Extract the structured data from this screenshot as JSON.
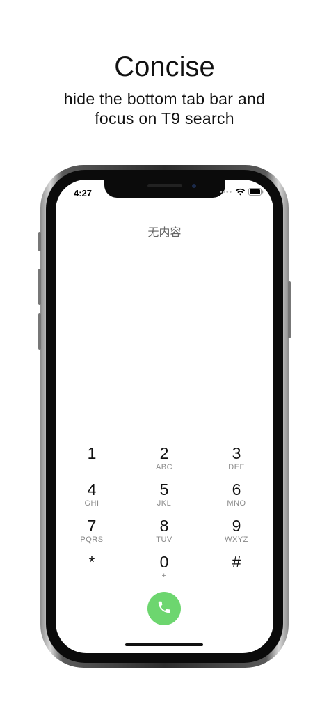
{
  "promo": {
    "title": "Concise",
    "subtitle_line1": "hide the bottom tab bar and",
    "subtitle_line2": "focus on T9 search"
  },
  "status_bar": {
    "time": "4:27",
    "signal_dots": "••••",
    "icons": [
      "wifi-icon",
      "battery-icon"
    ]
  },
  "results": {
    "empty_text": "无内容"
  },
  "keypad": {
    "keys": [
      {
        "digit": "1",
        "letters": ""
      },
      {
        "digit": "2",
        "letters": "ABC"
      },
      {
        "digit": "3",
        "letters": "DEF"
      },
      {
        "digit": "4",
        "letters": "GHI"
      },
      {
        "digit": "5",
        "letters": "JKL"
      },
      {
        "digit": "6",
        "letters": "MNO"
      },
      {
        "digit": "7",
        "letters": "PQRS"
      },
      {
        "digit": "8",
        "letters": "TUV"
      },
      {
        "digit": "9",
        "letters": "WXYZ"
      },
      {
        "digit": "*",
        "letters": ""
      },
      {
        "digit": "0",
        "letters": "+"
      },
      {
        "digit": "#",
        "letters": ""
      }
    ]
  },
  "call_button": {
    "icon": "phone-icon",
    "color": "#6dd66f"
  }
}
